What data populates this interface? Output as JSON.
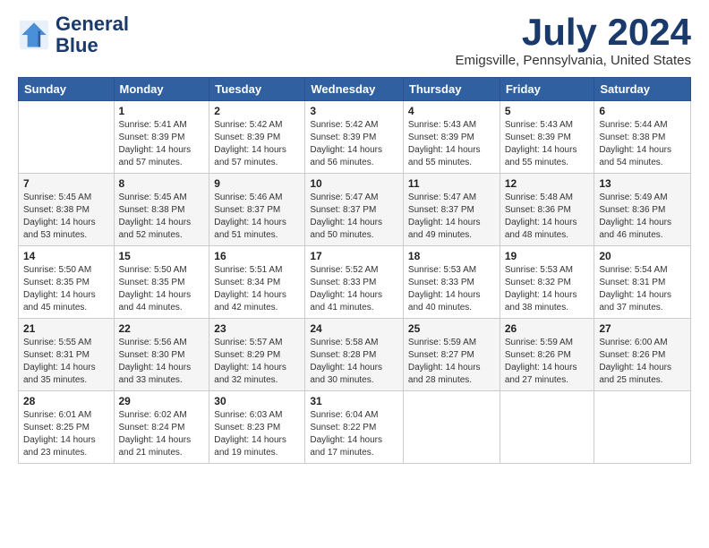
{
  "logo": {
    "line1": "General",
    "line2": "Blue"
  },
  "header": {
    "month": "July 2024",
    "location": "Emigsville, Pennsylvania, United States"
  },
  "days_of_week": [
    "Sunday",
    "Monday",
    "Tuesday",
    "Wednesday",
    "Thursday",
    "Friday",
    "Saturday"
  ],
  "weeks": [
    [
      {
        "day": "",
        "sunrise": "",
        "sunset": "",
        "daylight": ""
      },
      {
        "day": "1",
        "sunrise": "Sunrise: 5:41 AM",
        "sunset": "Sunset: 8:39 PM",
        "daylight": "Daylight: 14 hours and 57 minutes."
      },
      {
        "day": "2",
        "sunrise": "Sunrise: 5:42 AM",
        "sunset": "Sunset: 8:39 PM",
        "daylight": "Daylight: 14 hours and 57 minutes."
      },
      {
        "day": "3",
        "sunrise": "Sunrise: 5:42 AM",
        "sunset": "Sunset: 8:39 PM",
        "daylight": "Daylight: 14 hours and 56 minutes."
      },
      {
        "day": "4",
        "sunrise": "Sunrise: 5:43 AM",
        "sunset": "Sunset: 8:39 PM",
        "daylight": "Daylight: 14 hours and 55 minutes."
      },
      {
        "day": "5",
        "sunrise": "Sunrise: 5:43 AM",
        "sunset": "Sunset: 8:39 PM",
        "daylight": "Daylight: 14 hours and 55 minutes."
      },
      {
        "day": "6",
        "sunrise": "Sunrise: 5:44 AM",
        "sunset": "Sunset: 8:38 PM",
        "daylight": "Daylight: 14 hours and 54 minutes."
      }
    ],
    [
      {
        "day": "7",
        "sunrise": "Sunrise: 5:45 AM",
        "sunset": "Sunset: 8:38 PM",
        "daylight": "Daylight: 14 hours and 53 minutes."
      },
      {
        "day": "8",
        "sunrise": "Sunrise: 5:45 AM",
        "sunset": "Sunset: 8:38 PM",
        "daylight": "Daylight: 14 hours and 52 minutes."
      },
      {
        "day": "9",
        "sunrise": "Sunrise: 5:46 AM",
        "sunset": "Sunset: 8:37 PM",
        "daylight": "Daylight: 14 hours and 51 minutes."
      },
      {
        "day": "10",
        "sunrise": "Sunrise: 5:47 AM",
        "sunset": "Sunset: 8:37 PM",
        "daylight": "Daylight: 14 hours and 50 minutes."
      },
      {
        "day": "11",
        "sunrise": "Sunrise: 5:47 AM",
        "sunset": "Sunset: 8:37 PM",
        "daylight": "Daylight: 14 hours and 49 minutes."
      },
      {
        "day": "12",
        "sunrise": "Sunrise: 5:48 AM",
        "sunset": "Sunset: 8:36 PM",
        "daylight": "Daylight: 14 hours and 48 minutes."
      },
      {
        "day": "13",
        "sunrise": "Sunrise: 5:49 AM",
        "sunset": "Sunset: 8:36 PM",
        "daylight": "Daylight: 14 hours and 46 minutes."
      }
    ],
    [
      {
        "day": "14",
        "sunrise": "Sunrise: 5:50 AM",
        "sunset": "Sunset: 8:35 PM",
        "daylight": "Daylight: 14 hours and 45 minutes."
      },
      {
        "day": "15",
        "sunrise": "Sunrise: 5:50 AM",
        "sunset": "Sunset: 8:35 PM",
        "daylight": "Daylight: 14 hours and 44 minutes."
      },
      {
        "day": "16",
        "sunrise": "Sunrise: 5:51 AM",
        "sunset": "Sunset: 8:34 PM",
        "daylight": "Daylight: 14 hours and 42 minutes."
      },
      {
        "day": "17",
        "sunrise": "Sunrise: 5:52 AM",
        "sunset": "Sunset: 8:33 PM",
        "daylight": "Daylight: 14 hours and 41 minutes."
      },
      {
        "day": "18",
        "sunrise": "Sunrise: 5:53 AM",
        "sunset": "Sunset: 8:33 PM",
        "daylight": "Daylight: 14 hours and 40 minutes."
      },
      {
        "day": "19",
        "sunrise": "Sunrise: 5:53 AM",
        "sunset": "Sunset: 8:32 PM",
        "daylight": "Daylight: 14 hours and 38 minutes."
      },
      {
        "day": "20",
        "sunrise": "Sunrise: 5:54 AM",
        "sunset": "Sunset: 8:31 PM",
        "daylight": "Daylight: 14 hours and 37 minutes."
      }
    ],
    [
      {
        "day": "21",
        "sunrise": "Sunrise: 5:55 AM",
        "sunset": "Sunset: 8:31 PM",
        "daylight": "Daylight: 14 hours and 35 minutes."
      },
      {
        "day": "22",
        "sunrise": "Sunrise: 5:56 AM",
        "sunset": "Sunset: 8:30 PM",
        "daylight": "Daylight: 14 hours and 33 minutes."
      },
      {
        "day": "23",
        "sunrise": "Sunrise: 5:57 AM",
        "sunset": "Sunset: 8:29 PM",
        "daylight": "Daylight: 14 hours and 32 minutes."
      },
      {
        "day": "24",
        "sunrise": "Sunrise: 5:58 AM",
        "sunset": "Sunset: 8:28 PM",
        "daylight": "Daylight: 14 hours and 30 minutes."
      },
      {
        "day": "25",
        "sunrise": "Sunrise: 5:59 AM",
        "sunset": "Sunset: 8:27 PM",
        "daylight": "Daylight: 14 hours and 28 minutes."
      },
      {
        "day": "26",
        "sunrise": "Sunrise: 5:59 AM",
        "sunset": "Sunset: 8:26 PM",
        "daylight": "Daylight: 14 hours and 27 minutes."
      },
      {
        "day": "27",
        "sunrise": "Sunrise: 6:00 AM",
        "sunset": "Sunset: 8:26 PM",
        "daylight": "Daylight: 14 hours and 25 minutes."
      }
    ],
    [
      {
        "day": "28",
        "sunrise": "Sunrise: 6:01 AM",
        "sunset": "Sunset: 8:25 PM",
        "daylight": "Daylight: 14 hours and 23 minutes."
      },
      {
        "day": "29",
        "sunrise": "Sunrise: 6:02 AM",
        "sunset": "Sunset: 8:24 PM",
        "daylight": "Daylight: 14 hours and 21 minutes."
      },
      {
        "day": "30",
        "sunrise": "Sunrise: 6:03 AM",
        "sunset": "Sunset: 8:23 PM",
        "daylight": "Daylight: 14 hours and 19 minutes."
      },
      {
        "day": "31",
        "sunrise": "Sunrise: 6:04 AM",
        "sunset": "Sunset: 8:22 PM",
        "daylight": "Daylight: 14 hours and 17 minutes."
      },
      {
        "day": "",
        "sunrise": "",
        "sunset": "",
        "daylight": ""
      },
      {
        "day": "",
        "sunrise": "",
        "sunset": "",
        "daylight": ""
      },
      {
        "day": "",
        "sunrise": "",
        "sunset": "",
        "daylight": ""
      }
    ]
  ]
}
